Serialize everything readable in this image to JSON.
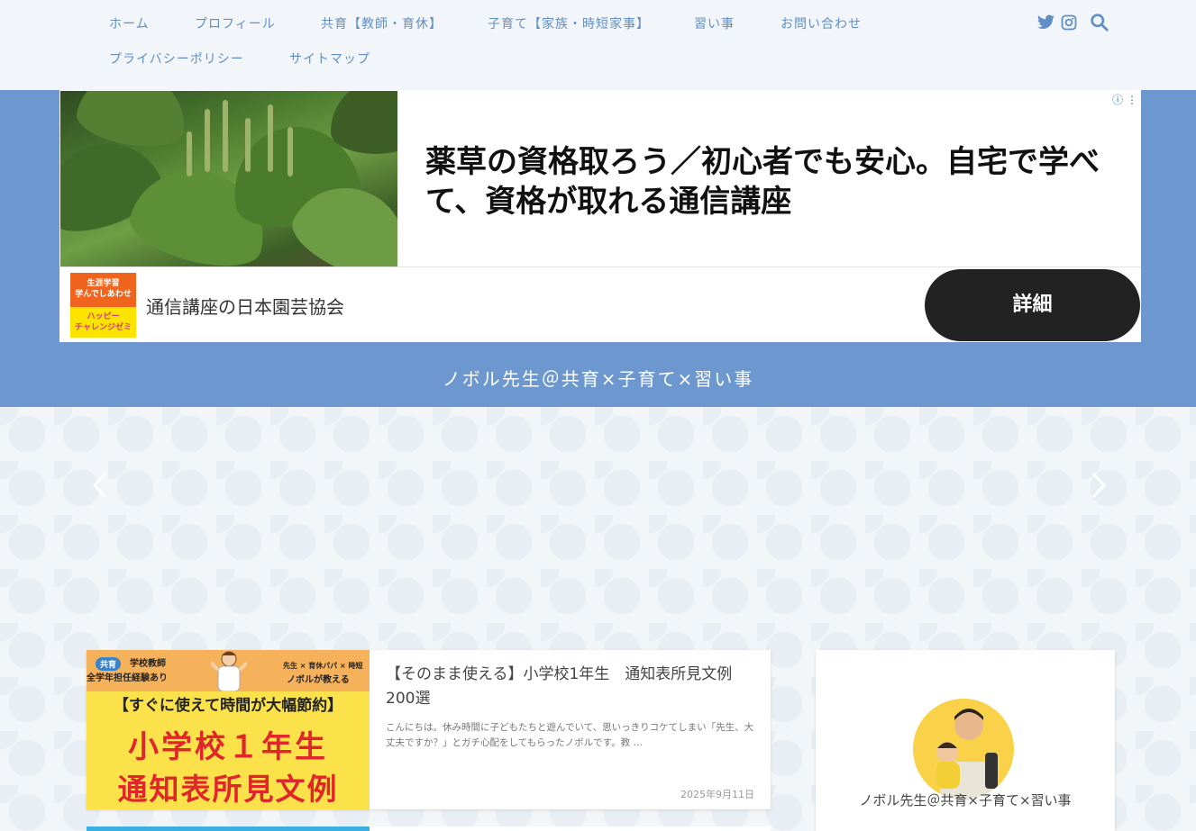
{
  "nav": {
    "items": [
      {
        "label": "ホーム"
      },
      {
        "label": "プロフィール"
      },
      {
        "label": "共育【教師・育休】"
      },
      {
        "label": "子育て【家族・時短家事】"
      },
      {
        "label": "習い事"
      },
      {
        "label": "お問い合わせ"
      },
      {
        "label": "プライバシーポリシー"
      },
      {
        "label": "サイトマップ"
      }
    ],
    "icons": [
      "twitter-icon",
      "instagram-icon",
      "search-icon"
    ],
    "link_color": "#5f8fc4"
  },
  "ad": {
    "headline": "薬草の資格取ろう／初心者でも安心。自宅で学べて、資格が取れる通信講座",
    "logo_top": "生涯学習\n学んでしあわせ",
    "logo_bottom": "ハッピー\nチャレンジゼミ",
    "advertiser": "通信講座の日本園芸協会",
    "cta": "詳細"
  },
  "site": {
    "title": "ノボル先生＠共育×子育て×習い事",
    "band_color": "#6c97cf"
  },
  "article": {
    "thumb": {
      "badge": "共育",
      "line1": "学校教師",
      "line2": "全学年担任経験あり",
      "right1": "先生 × 育休パパ × 時短",
      "right2": "ノボルが教える",
      "banner": "【すぐに使えて時間が大幅節約】",
      "big1": "小学校１年生",
      "big2": "通知表所見文例"
    },
    "title": "【そのまま使える】小学校1年生　通知表所見文例200選",
    "excerpt": "こんにちは。休み時間に子どもたちと遊んでいて、思いっきりコケてしまい「先生、大丈夫ですか？」とガチ心配をしてもらったノボルです。教 …",
    "date": "2025年9月11日"
  },
  "profile": {
    "name": "ノボル先生＠共育×子育て×習い事"
  }
}
